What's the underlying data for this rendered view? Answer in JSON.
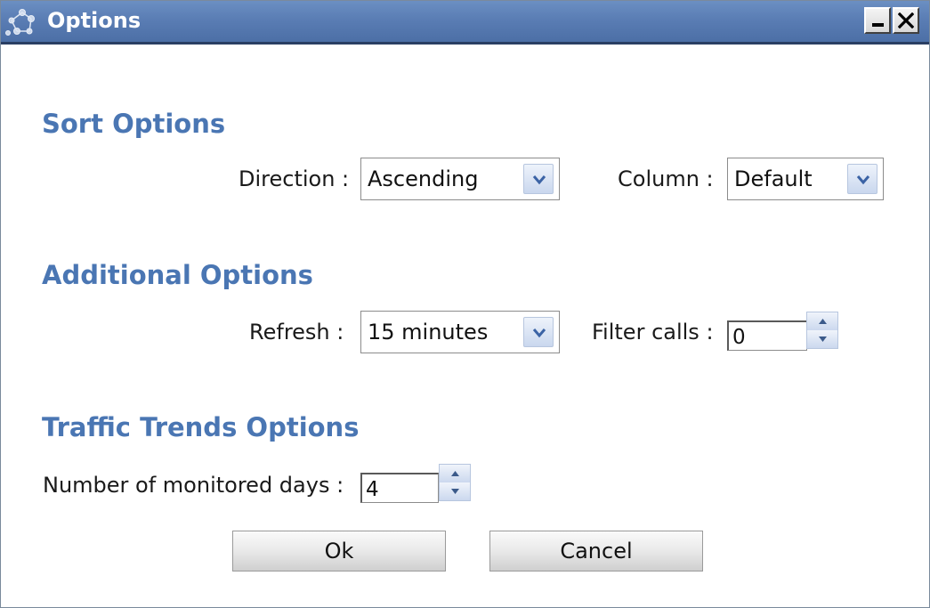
{
  "window": {
    "title": "Options",
    "icon": "network-nodes-icon"
  },
  "sort_options": {
    "heading": "Sort Options",
    "direction_label": "Direction :",
    "direction_value": "Ascending",
    "column_label": "Column :",
    "column_value": "Default"
  },
  "additional_options": {
    "heading": "Additional Options",
    "refresh_label": "Refresh :",
    "refresh_value": "15 minutes",
    "filter_calls_label": "Filter calls :",
    "filter_calls_value": "0"
  },
  "traffic_trends": {
    "heading": "Traffic Trends Options",
    "monitored_days_label": "Number of monitored days :",
    "monitored_days_value": "4"
  },
  "buttons": {
    "ok": "Ok",
    "cancel": "Cancel"
  },
  "colors": {
    "title_bar": "#5a7db4",
    "section_heading": "#4a76b3"
  }
}
